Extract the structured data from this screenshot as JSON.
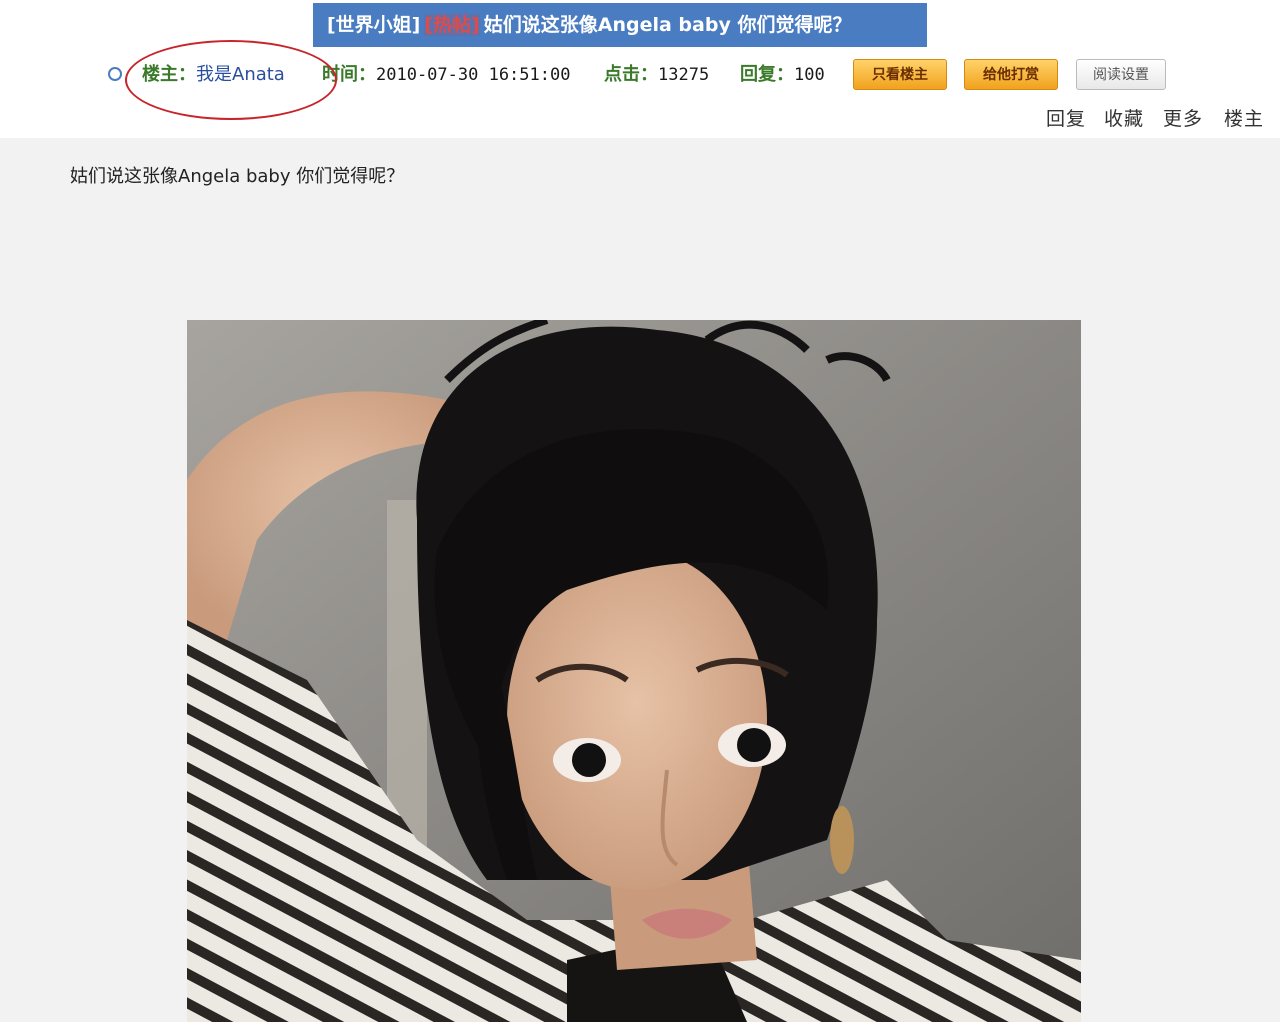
{
  "thread": {
    "board_tag": "[世界小姐]",
    "hot_tag": "[热帖]",
    "title": "姑们说这张像Angela baby 你们觉得呢？"
  },
  "meta": {
    "author_label": "楼主：",
    "author_name": "我是Anata",
    "time_label": "时间：",
    "time_value": "2010-07-30 16:51:00",
    "clicks_label": "点击：",
    "clicks_value": "13275",
    "replies_label": "回复：",
    "replies_value": "100"
  },
  "buttons": {
    "only_op": "只看楼主",
    "tip": "给他打赏",
    "read_settings": "阅读设置"
  },
  "actions": [
    "回复",
    "收藏",
    "更多",
    "楼主"
  ],
  "post": {
    "text": "姑们说这张像Angela baby 你们觉得呢？"
  },
  "colors": {
    "title_bar": "#4a7cc2",
    "highlight_ring": "#c8242b",
    "button_orange": "#f1a21c",
    "meta_key": "#3a7a2a"
  }
}
